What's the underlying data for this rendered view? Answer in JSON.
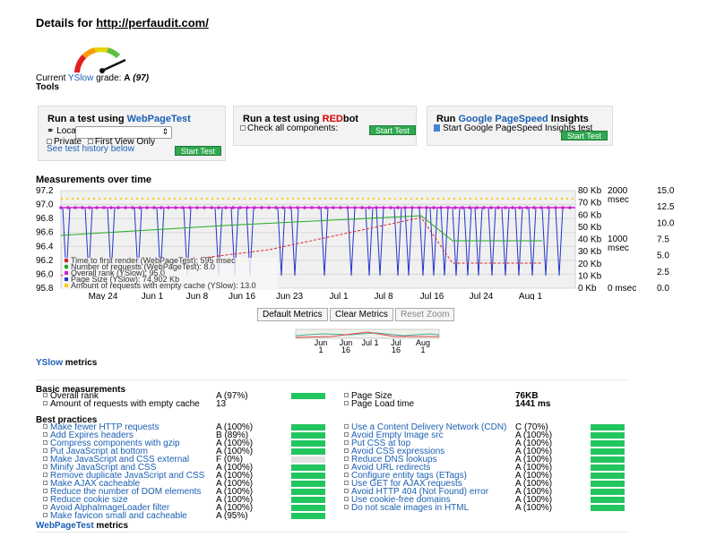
{
  "header": {
    "details_prefix": "Details for ",
    "url": "http://perfaudit.com/",
    "grade_prefix": "Current ",
    "yslow_link": "YSlow",
    "grade_mid": " grade: ",
    "grade_letter": "A",
    "grade_score": "(97)",
    "tools": "Tools"
  },
  "panels": {
    "wpt": {
      "title_prefix": "Run a test using ",
      "title_link": "WebPageTest",
      "location_label": "Location:",
      "private_label": "Private",
      "first_view_label": "First View Only",
      "history_link": "See test history below",
      "start": "Start Test"
    },
    "redbot": {
      "title_prefix": "Run a test using ",
      "title_red": "RED",
      "title_suffix": "bot",
      "check_label": "Check all components:",
      "start": "Start Test"
    },
    "pagespeed": {
      "title_prefix": "Run ",
      "title_link": "Google PageSpeed",
      "title_suffix": " Insights",
      "start_label": "Start Google PageSpeed Insights test",
      "start": "Start Test"
    }
  },
  "measurements": {
    "title": "Measurements over time",
    "buttons": [
      "Default Metrics",
      "Clear Metrics",
      "Reset Zoom"
    ],
    "legend": [
      "Time to first render (WebPageTest): 595 msec",
      "Number of requests (WebPageTest): 8.0",
      "Overall rank (YSlow): 95.0",
      "Page Size (YSlow): 74,902 Kb",
      "Amount of requests with empty cache (YSlow): 13.0"
    ],
    "y_left": [
      "97.2",
      "97.0",
      "96.8",
      "96.6",
      "96.4",
      "96.2",
      "96.0",
      "95.8"
    ],
    "y_kb": [
      "80 Kb",
      "70 Kb",
      "60 Kb",
      "50 Kb",
      "40 Kb",
      "30 Kb",
      "20 Kb",
      "10 Kb",
      "0 Kb"
    ],
    "y_msec": [
      "2000",
      "msec",
      "1000",
      "msec",
      "0 msec"
    ],
    "y_right": [
      "15.0",
      "12.5",
      "10.0",
      "7.5",
      "5.0",
      "2.5",
      "0.0"
    ],
    "x_labels": [
      "May 24",
      "Jun 1",
      "Jun 8",
      "Jun 16",
      "Jun 23",
      "Jul 1",
      "Jul 8",
      "Jul 16",
      "Jul 24",
      "Aug 1"
    ],
    "nav_labels": [
      {
        "top": "Jun",
        "bot": "1"
      },
      {
        "top": "Jun",
        "bot": "16"
      },
      {
        "top": "Jul 1",
        "bot": ""
      },
      {
        "top": "Jul",
        "bot": "16"
      },
      {
        "top": "Aug",
        "bot": "1"
      }
    ]
  },
  "chart_data": {
    "type": "line",
    "x_range": [
      "May 18",
      "Aug 8"
    ],
    "series": [
      {
        "name": "Overall rank (YSlow)",
        "color": "#d020d0",
        "values_note": "constant",
        "y": 97.0
      },
      {
        "name": "Number of requests (WebPageTest)",
        "color": "#22aa22"
      },
      {
        "name": "Time to first render (WebPageTest)",
        "color": "#dd2222"
      },
      {
        "name": "Page Size (YSlow)",
        "color": "#2233cc"
      },
      {
        "name": "Amount of requests with empty cache (YSlow)",
        "color": "#ffcc00"
      }
    ],
    "ylim_left": [
      95.8,
      97.2
    ],
    "ylim_kb": [
      0,
      80
    ],
    "ylim_msec": [
      0,
      2000
    ],
    "ylim_right": [
      0.0,
      15.0
    ]
  },
  "yslow": {
    "title_link": "YSlow",
    "title_suffix": " metrics",
    "basic_title": "Basic measurements",
    "basic_left": [
      {
        "label": "Overall rank",
        "grade": "A",
        "score": "(97%)",
        "pct": 97
      },
      {
        "label": "Amount of requests with empty cache",
        "grade": "13",
        "score": "",
        "pct": null
      }
    ],
    "basic_right": [
      {
        "label": "Page Size",
        "value": "76KB"
      },
      {
        "label": "Page Load time",
        "value": "1441 ms"
      }
    ],
    "best_title": "Best practices",
    "best_left": [
      {
        "label": "Make fewer HTTP requests",
        "grade": "A",
        "score": "(100%)",
        "pct": 100
      },
      {
        "label": "Add Expires headers",
        "grade": "B",
        "score": "(89%)",
        "pct": 89
      },
      {
        "label": "Compress components with gzip",
        "grade": "A",
        "score": "(100%)",
        "pct": 100
      },
      {
        "label": "Put JavaScript at bottom",
        "grade": "A",
        "score": "(100%)",
        "pct": 100
      },
      {
        "label": "Make JavaScript and CSS external",
        "grade": "F",
        "score": "(0%)",
        "pct": 0
      },
      {
        "label": "Minify JavaScript and CSS",
        "grade": "A",
        "score": "(100%)",
        "pct": 100
      },
      {
        "label": "Remove duplicate JavaScript and CSS",
        "grade": "A",
        "score": "(100%)",
        "pct": 100
      },
      {
        "label": "Make AJAX cacheable",
        "grade": "A",
        "score": "(100%)",
        "pct": 100
      },
      {
        "label": "Reduce the number of DOM elements",
        "grade": "A",
        "score": "(100%)",
        "pct": 100
      },
      {
        "label": "Reduce cookie size",
        "grade": "A",
        "score": "(100%)",
        "pct": 100
      },
      {
        "label": "Avoid AlphaImageLoader filter",
        "grade": "A",
        "score": "(100%)",
        "pct": 100
      },
      {
        "label": "Make favicon small and cacheable",
        "grade": "A",
        "score": "(95%)",
        "pct": 95
      }
    ],
    "best_right": [
      {
        "label": "Use a Content Delivery Network (CDN)",
        "grade": "C",
        "score": "(70%)",
        "pct": 70
      },
      {
        "label": "Avoid Empty Image src",
        "grade": "A",
        "score": "(100%)",
        "pct": 100
      },
      {
        "label": "Put CSS at top",
        "grade": "A",
        "score": "(100%)",
        "pct": 100
      },
      {
        "label": "Avoid CSS expressions",
        "grade": "A",
        "score": "(100%)",
        "pct": 100
      },
      {
        "label": "Reduce DNS lookups",
        "grade": "A",
        "score": "(100%)",
        "pct": 100
      },
      {
        "label": "Avoid URL redirects",
        "grade": "A",
        "score": "(100%)",
        "pct": 100
      },
      {
        "label": "Configure entity tags (ETags)",
        "grade": "A",
        "score": "(100%)",
        "pct": 100
      },
      {
        "label": "Use GET for AJAX requests",
        "grade": "A",
        "score": "(100%)",
        "pct": 100
      },
      {
        "label": "Avoid HTTP 404 (Not Found) error",
        "grade": "A",
        "score": "(100%)",
        "pct": 100
      },
      {
        "label": "Use cookie-free domains",
        "grade": "A",
        "score": "(100%)",
        "pct": 100
      },
      {
        "label": "Do not scale images in HTML",
        "grade": "A",
        "score": "(100%)",
        "pct": 100
      }
    ]
  },
  "webpagetest": {
    "title_link": "WebPageTest",
    "title_suffix": " metrics"
  }
}
